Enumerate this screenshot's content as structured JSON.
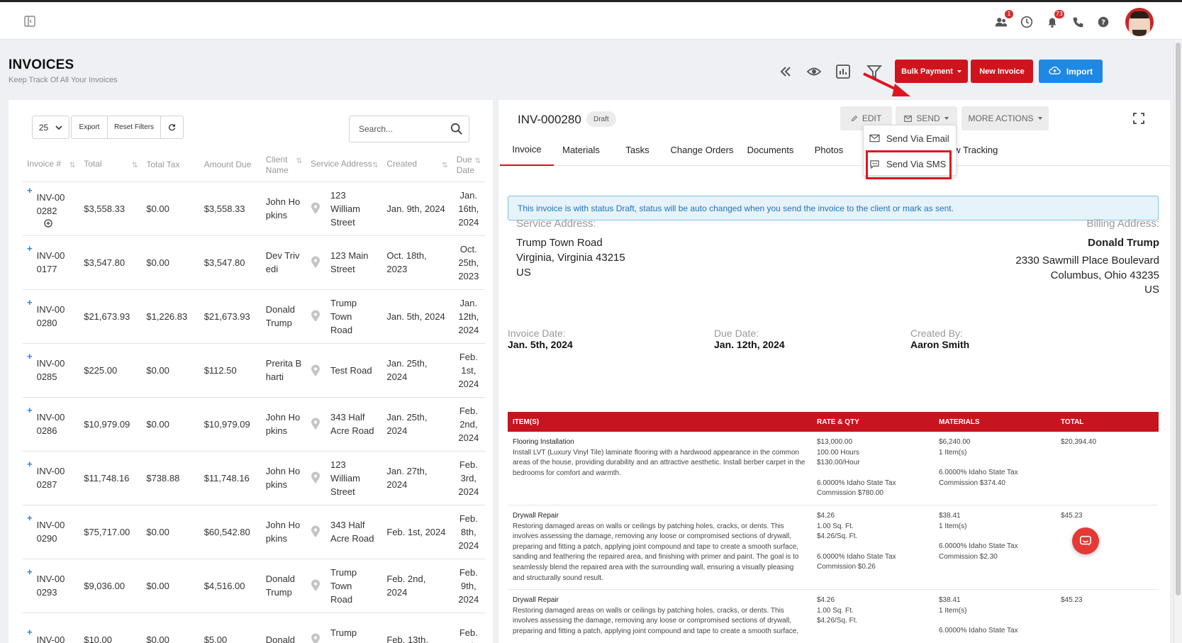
{
  "header": {
    "title": "INVOICES",
    "subtitle": "Keep Track Of All Your Invoices",
    "bulk_payment_label": "Bulk Payment",
    "new_invoice_label": "New Invoice",
    "import_label": "Import"
  },
  "topbar": {
    "team_badge": "1",
    "notif_badge": "73"
  },
  "list": {
    "page_size": "25",
    "export_label": "Export",
    "reset_filters_label": "Reset Filters",
    "search_placeholder": "Search...",
    "columns": [
      "Invoice #",
      "Total",
      "Total Tax",
      "Amount Due",
      "Client Name",
      "Service Address",
      "Created",
      "Due Date"
    ],
    "rows": [
      {
        "invoice": "INV-00 0282",
        "total": "$3,558.33",
        "tax": "$0.00",
        "due_amount": "$3,558.33",
        "client": "John Ho pkins",
        "address": "123 William Street",
        "created": "Jan. 9th, 2024",
        "due_date": "Jan. 16th, 2024"
      },
      {
        "invoice": "INV-00 0177",
        "total": "$3,547.80",
        "tax": "$0.00",
        "due_amount": "$3,547.80",
        "client": "Dev Triv edi",
        "address": "123 Main Street",
        "created": "Oct. 18th, 2023",
        "due_date": "Oct. 25th, 2023"
      },
      {
        "invoice": "INV-00 0280",
        "total": "$21,673.93",
        "tax": "$1,226.83",
        "due_amount": "$21,673.93",
        "client": "Donald Trump",
        "address": "Trump Town Road",
        "created": "Jan. 5th, 2024",
        "due_date": "Jan. 12th, 2024"
      },
      {
        "invoice": "INV-00 0285",
        "total": "$225.00",
        "tax": "$0.00",
        "due_amount": "$112.50",
        "client": "Prerita B harti",
        "address": "Test Road",
        "created": "Jan. 25th, 2024",
        "due_date": "Feb. 1st, 2024"
      },
      {
        "invoice": "INV-00 0286",
        "total": "$10,979.09",
        "tax": "$0.00",
        "due_amount": "$10,979.09",
        "client": "John Ho pkins",
        "address": "343 Half Acre Road",
        "created": "Jan. 25th, 2024",
        "due_date": "Feb. 2nd, 2024"
      },
      {
        "invoice": "INV-00 0287",
        "total": "$11,748.16",
        "tax": "$738.88",
        "due_amount": "$11,748.16",
        "client": "John Ho pkins",
        "address": "123 William Street",
        "created": "Jan. 27th, 2024",
        "due_date": "Feb. 3rd, 2024"
      },
      {
        "invoice": "INV-00 0290",
        "total": "$75,717.00",
        "tax": "$0.00",
        "due_amount": "$60,542.80",
        "client": "John Ho pkins",
        "address": "343 Half Acre Road",
        "created": "Feb. 1st, 2024",
        "due_date": "Feb. 8th, 2024"
      },
      {
        "invoice": "INV-00 0293",
        "total": "$9,036.00",
        "tax": "$0.00",
        "due_amount": "$4,516.00",
        "client": "Donald Trump",
        "address": "Trump Town Road",
        "created": "Feb. 2nd, 2024",
        "due_date": "Feb. 9th, 2024"
      },
      {
        "invoice": "INV-00",
        "total": "$10.00",
        "tax": "$0.00",
        "due_amount": "$5.00",
        "client": "Donald",
        "address": "Trump Town",
        "created": "Feb. 13th,",
        "due_date": "Feb. 20th,"
      }
    ]
  },
  "detail": {
    "invoice_number": "INV-000280",
    "status": "Draft",
    "edit_label": "EDIT",
    "send_label": "SEND",
    "more_actions_label": "MORE ACTIONS",
    "tabs": [
      "Invoice",
      "Materials",
      "Tasks",
      "Change Orders",
      "Documents",
      "Photos",
      "Note",
      "View Tracking"
    ],
    "alert": "This invoice is with status Draft, status will be auto changed when you send the invoice to the client or mark as sent.",
    "service_address_label": "Service Address:",
    "service_address": [
      "Trump Town Road",
      "Virginia, Virginia 43215",
      "US"
    ],
    "billing_address_label": "Billing Address:",
    "billing_name": "Donald Trump",
    "billing_address": [
      "2330 Sawmill Place Boulevard",
      "Columbus, Ohio 43235",
      "US"
    ],
    "invoice_date_label": "Invoice Date:",
    "invoice_date": "Jan. 5th, 2024",
    "due_date_label": "Due Date:",
    "due_date": "Jan. 12th, 2024",
    "created_by_label": "Created By:",
    "created_by": "Aaron Smith",
    "item_columns": [
      "ITEM(S)",
      "RATE & QTY",
      "MATERIALS",
      "TOTAL"
    ],
    "items": [
      {
        "name": "Flooring Installation",
        "description": "Install LVT (Luxury Vinyl Tile) laminate flooring with a hardwood appearance in the common areas of the house, providing durability and an attractive aesthetic. Install berber carpet in the bedrooms for comfort and warmth.",
        "rate": "$13,000.00",
        "qty": "100.00 Hours",
        "unit_rate": "$130.00/Hour",
        "rate_tax": "6.0000% Idaho State Tax",
        "rate_commission": "Commission $780.00",
        "materials": "$6,240.00",
        "materials_qty": "1 Item(s)",
        "materials_tax": "6.0000% Idaho State Tax",
        "materials_commission": "Commission $374.40",
        "total": "$20,394.40"
      },
      {
        "name": "Drywall Repair",
        "description": "Restoring damaged areas on walls or ceilings by patching holes, cracks, or dents. This involves assessing the damage, removing any loose or compromised sections of drywall, preparing and fitting a patch, applying joint compound and tape to create a smooth surface, sanding and feathering the repaired area, and finishing with primer and paint. The goal is to seamlessly blend the repaired area with the surrounding wall, ensuring a visually pleasing and structurally sound result.",
        "rate": "$4.26",
        "qty": "1.00 Sq. Ft.",
        "unit_rate": "$4.26/Sq. Ft.",
        "rate_tax": "6.0000% Idaho State Tax",
        "rate_commission": "Commission $0.26",
        "materials": "$38.41",
        "materials_qty": "1 Item(s)",
        "materials_tax": "6.0000% Idaho State Tax",
        "materials_commission": "Commission $2.30",
        "total": "$45.23"
      },
      {
        "name": "Drywall Repair",
        "description": "Restoring damaged areas on walls or ceilings by patching holes, cracks, or dents. This involves assessing the damage, removing any loose or compromised sections of drywall, preparing and fitting a patch, applying joint compound and tape to create a smooth surface,",
        "rate": "$4.26",
        "qty": "1.00 Sq. Ft.",
        "unit_rate": "$4.26/Sq. Ft.",
        "rate_tax": "",
        "rate_commission": "",
        "materials": "$38.41",
        "materials_qty": "1 Item(s)",
        "materials_tax": "6.0000% Idaho State Tax",
        "materials_commission": "",
        "total": "$45.23"
      }
    ]
  },
  "send_menu": {
    "email_label": "Send Via Email",
    "sms_label": "Send Via SMS"
  },
  "colors": {
    "brand_red": "#d0141e",
    "primary_blue": "#1e88e5",
    "highlight": "#e0141e"
  }
}
